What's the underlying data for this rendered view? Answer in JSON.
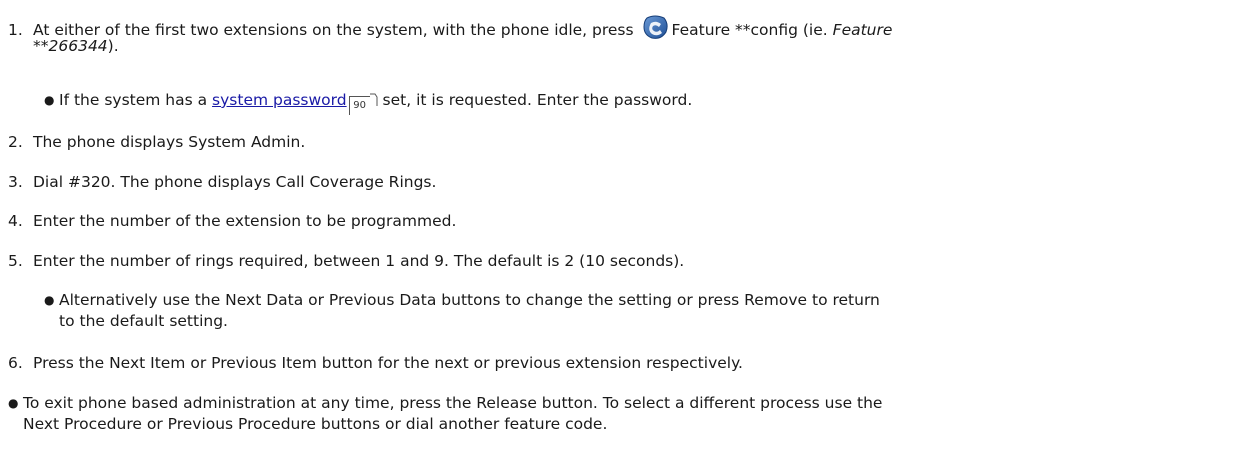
{
  "steps": [
    {
      "num": "1.",
      "text_a": "At either of the first two extensions on the system, with the phone idle, press",
      "text_b": "Feature **config (ie.",
      "text_em": "Feature",
      "text_em2": "**266344",
      "text_end": ")."
    },
    {
      "num": "2.",
      "text": "The phone displays System Admin."
    },
    {
      "num": "3.",
      "text": "Dial #320. The phone displays Call Coverage Rings."
    },
    {
      "num": "4.",
      "text": "Enter the number of the extension to be programmed."
    },
    {
      "num": "5.",
      "text": "Enter the number of rings required, between 1 and 9. The default is 2 (10 seconds)."
    },
    {
      "num": "6.",
      "text": "Press the Next Item or Previous Item button for the next or previous extension respectively."
    }
  ],
  "sub1": {
    "pre": "If the system has a",
    "link": "system password",
    "pageref": "90",
    "post": "set, it is requested. Enter the password."
  },
  "sub5": {
    "line1": "Alternatively use the Next Data or Previous Data buttons to change the setting or press Remove to return",
    "line2": "to the default setting."
  },
  "note": {
    "line1": "To exit phone based administration at any time, press the Release button. To select a different process use the",
    "line2": "Next Procedure or Previous Procedure buttons or dial another feature code."
  },
  "icons": {
    "feature_button": "feature-key-icon",
    "page_reference": "page-reference-icon"
  },
  "colors": {
    "link": "#1a1aa6",
    "icon_blue": "#1e5aa8"
  }
}
